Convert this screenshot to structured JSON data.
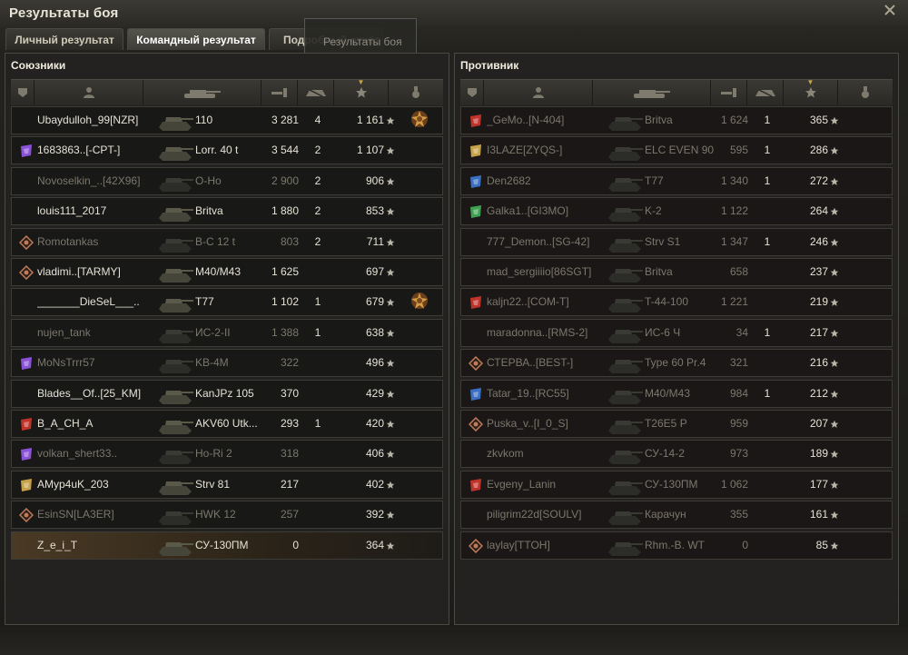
{
  "window": {
    "title": "Результаты боя"
  },
  "tabs": [
    {
      "label": "Личный результат",
      "active": false
    },
    {
      "label": "Командный результат",
      "active": true
    },
    {
      "label": "Подробный отчёт",
      "active": false
    }
  ],
  "tooltip": {
    "text": "Результаты боя"
  },
  "allies": {
    "title": "Союзники",
    "rows": [
      {
        "name": "Ubaydulloh_99[NZR]",
        "tank": "110",
        "damage": "3 281",
        "kills": "4",
        "xp": "1 161",
        "badge": "medal",
        "clan": "",
        "alive": true,
        "self": false
      },
      {
        "name": "1683863..[-CPT-]",
        "tank": "Lorr. 40 t",
        "damage": "3 544",
        "kills": "2",
        "xp": "1 107",
        "badge": "",
        "clan": "purple",
        "alive": true,
        "self": false
      },
      {
        "name": "Novoselkin_..[42X96]",
        "tank": "O-Ho",
        "damage": "2 900",
        "kills": "2",
        "xp": "906",
        "badge": "",
        "clan": "",
        "alive": false,
        "self": false
      },
      {
        "name": "louis111_2017",
        "tank": "Britva",
        "damage": "1 880",
        "kills": "2",
        "xp": "853",
        "badge": "",
        "clan": "",
        "alive": true,
        "self": false
      },
      {
        "name": "Romotankas",
        "tank": "B-C 12 t",
        "damage": "803",
        "kills": "2",
        "xp": "711",
        "badge": "",
        "clan": "diamond",
        "alive": false,
        "self": false
      },
      {
        "name": "vladimi..[TARMY]",
        "tank": "M40/M43",
        "damage": "1 625",
        "kills": "",
        "xp": "697",
        "badge": "",
        "clan": "diamond",
        "alive": true,
        "self": false
      },
      {
        "name": "_______DieSeL___..",
        "tank": "T77",
        "damage": "1 102",
        "kills": "1",
        "xp": "679",
        "badge": "medal",
        "clan": "",
        "alive": true,
        "self": false
      },
      {
        "name": "nujen_tank",
        "tank": "ИС-2-II",
        "damage": "1 388",
        "kills": "1",
        "xp": "638",
        "badge": "",
        "clan": "",
        "alive": false,
        "self": false
      },
      {
        "name": "MoNsTrrr57",
        "tank": "KB-4M",
        "damage": "322",
        "kills": "",
        "xp": "496",
        "badge": "",
        "clan": "purple",
        "alive": false,
        "self": false
      },
      {
        "name": "Blades__Of..[25_KM]",
        "tank": "KanJPz 105",
        "damage": "370",
        "kills": "",
        "xp": "429",
        "badge": "",
        "clan": "",
        "alive": true,
        "self": false
      },
      {
        "name": "B_A_CH_A",
        "tank": "AKV60 Utk...",
        "damage": "293",
        "kills": "1",
        "xp": "420",
        "badge": "",
        "clan": "red",
        "alive": true,
        "self": false
      },
      {
        "name": "volkan_shert33..",
        "tank": "Ho-Ri 2",
        "damage": "318",
        "kills": "",
        "xp": "406",
        "badge": "",
        "clan": "purple",
        "alive": false,
        "self": false
      },
      {
        "name": "AMyp4uK_203",
        "tank": "Strv 81",
        "damage": "217",
        "kills": "",
        "xp": "402",
        "badge": "",
        "clan": "gold",
        "alive": true,
        "self": false
      },
      {
        "name": "EsinSN[LA3ER]",
        "tank": "HWK 12",
        "damage": "257",
        "kills": "",
        "xp": "392",
        "badge": "",
        "clan": "diamond",
        "alive": false,
        "self": false
      },
      {
        "name": "Z_e_i_T",
        "tank": "СУ-130ПМ",
        "damage": "0",
        "kills": "",
        "xp": "364",
        "badge": "",
        "clan": "",
        "alive": true,
        "self": true
      }
    ]
  },
  "enemies": {
    "title": "Противник",
    "rows": [
      {
        "name": "_GeMo..[N-404]",
        "tank": "Britva",
        "damage": "1 624",
        "kills": "1",
        "xp": "365",
        "clan": "red",
        "alive": false
      },
      {
        "name": "I3LAZE[ZYQS-]",
        "tank": "ELC EVEN 90",
        "damage": "595",
        "kills": "1",
        "xp": "286",
        "clan": "gold",
        "alive": false
      },
      {
        "name": "Den2682",
        "tank": "T77",
        "damage": "1 340",
        "kills": "1",
        "xp": "272",
        "clan": "blue",
        "alive": false
      },
      {
        "name": "Galka1..[GI3MO]",
        "tank": "K-2",
        "damage": "1 122",
        "kills": "",
        "xp": "264",
        "clan": "green",
        "alive": false
      },
      {
        "name": "777_Demon..[SG-42]",
        "tank": "Strv S1",
        "damage": "1 347",
        "kills": "1",
        "xp": "246",
        "clan": "",
        "alive": false
      },
      {
        "name": "mad_sergiiiio[86SGT]",
        "tank": "Britva",
        "damage": "658",
        "kills": "",
        "xp": "237",
        "clan": "",
        "alive": false
      },
      {
        "name": "kaljn22..[COM-T]",
        "tank": "T-44-100",
        "damage": "1 221",
        "kills": "",
        "xp": "219",
        "clan": "red",
        "alive": false
      },
      {
        "name": "maradonna..[RMS-2]",
        "tank": "ИС-6 Ч",
        "damage": "34",
        "kills": "1",
        "xp": "217",
        "clan": "",
        "alive": false
      },
      {
        "name": "СТЕРВА..[BEST-]",
        "tank": "Type 60 Pr.4",
        "damage": "321",
        "kills": "",
        "xp": "216",
        "clan": "diamond",
        "alive": false
      },
      {
        "name": "Tatar_19..[RC55]",
        "tank": "M40/M43",
        "damage": "984",
        "kills": "1",
        "xp": "212",
        "clan": "blue",
        "alive": false
      },
      {
        "name": "Puska_v..[I_0_S]",
        "tank": "T26E5 P",
        "damage": "959",
        "kills": "",
        "xp": "207",
        "clan": "diamond",
        "alive": false
      },
      {
        "name": "zkvkom",
        "tank": "СУ-14-2",
        "damage": "973",
        "kills": "",
        "xp": "189",
        "clan": "",
        "alive": false
      },
      {
        "name": "Evgeny_Lanin",
        "tank": "СУ-130ПМ",
        "damage": "1 062",
        "kills": "",
        "xp": "177",
        "clan": "red",
        "alive": false
      },
      {
        "name": "piligrim22d[SOULV]",
        "tank": "Карачун",
        "damage": "355",
        "kills": "",
        "xp": "161",
        "clan": "",
        "alive": false
      },
      {
        "name": "laylay[TTOH]",
        "tank": "Rhm.-B. WT",
        "damage": "0",
        "kills": "",
        "xp": "85",
        "clan": "diamond",
        "alive": false
      }
    ]
  },
  "icons": {
    "star": "star-icon",
    "sort": "sort-desc-icon"
  },
  "colors": {
    "clan_purple": "#8a52d6",
    "clan_red": "#c0332a",
    "clan_gold": "#c7a24a",
    "clan_blue": "#3b6fc4",
    "clan_green": "#3fa052",
    "clan_diamond": "#c07b5a"
  }
}
